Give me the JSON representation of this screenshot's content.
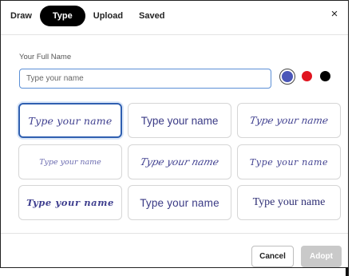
{
  "tabs": [
    {
      "label": "Draw"
    },
    {
      "label": "Type",
      "active": true
    },
    {
      "label": "Upload"
    },
    {
      "label": "Saved"
    }
  ],
  "close_label": "×",
  "name_field": {
    "label": "Your Full Name",
    "value": "",
    "placeholder": "Type your name"
  },
  "colors": {
    "options": [
      {
        "name": "blue",
        "hex": "#4a56b8",
        "selected": true
      },
      {
        "name": "red",
        "hex": "#e0141f"
      },
      {
        "name": "black",
        "hex": "#000000"
      }
    ]
  },
  "signature_styles": [
    {
      "text": "Type your name",
      "selected": true
    },
    {
      "text": "Type your name"
    },
    {
      "text": "Type your name"
    },
    {
      "text": "Type your name"
    },
    {
      "text": "Type your name"
    },
    {
      "text": "Type your name"
    },
    {
      "text": "Type your name"
    },
    {
      "text": "Type your name"
    },
    {
      "text": "Type your name"
    }
  ],
  "footer": {
    "cancel_label": "Cancel",
    "adopt_label": "Adopt",
    "adopt_enabled": false
  },
  "theme": {
    "accent": "#2f5fb0",
    "signature_ink": "#3f3f8f"
  }
}
